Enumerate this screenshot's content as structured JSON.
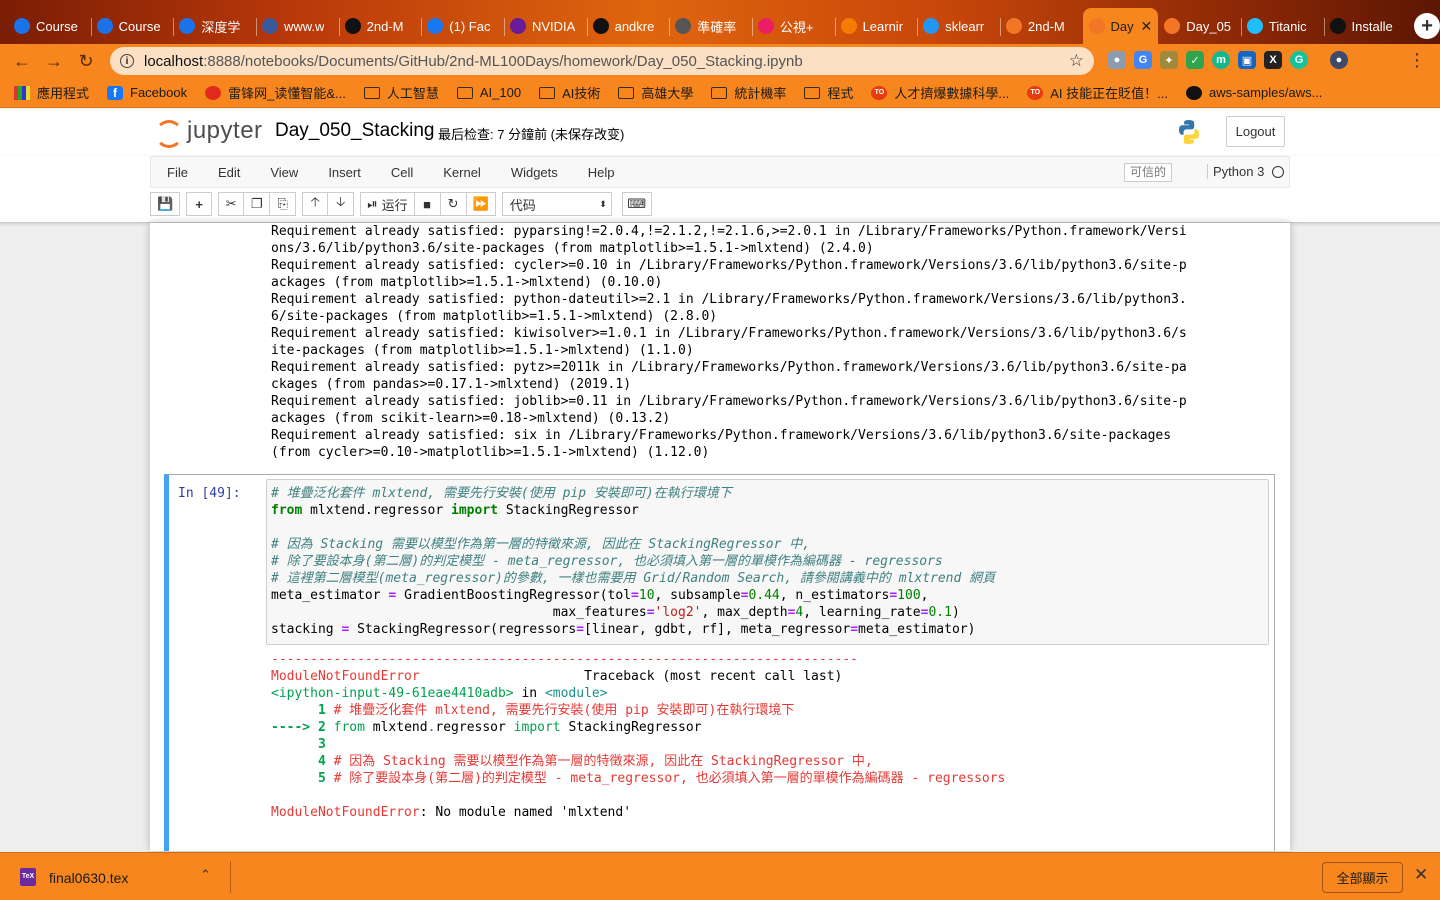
{
  "browser": {
    "tabs": [
      {
        "title": "Course",
        "icon": "infinity-icon",
        "color": "#1a73e8"
      },
      {
        "title": "Course",
        "icon": "infinity-icon",
        "color": "#1a73e8"
      },
      {
        "title": "深度学",
        "icon": "infinity-icon",
        "color": "#1a73e8"
      },
      {
        "title": "www.w",
        "icon": "bookmark-icon",
        "color": "#3b5998"
      },
      {
        "title": "2nd-M",
        "icon": "github-icon",
        "color": "#111111"
      },
      {
        "title": "(1) Fac",
        "icon": "facebook-icon",
        "color": "#1877f2"
      },
      {
        "title": "NVIDIA",
        "icon": "nvidia-icon",
        "color": "#6a1b9a"
      },
      {
        "title": "andkre",
        "icon": "github-icon",
        "color": "#111111"
      },
      {
        "title": "準確率",
        "icon": "globe-icon",
        "color": "#555555"
      },
      {
        "title": "公視+",
        "icon": "heart-icon",
        "color": "#e91e63"
      },
      {
        "title": "Learnir",
        "icon": "hexagon-icon",
        "color": "#f57c00"
      },
      {
        "title": "sklearr",
        "icon": "sklearn-icon",
        "color": "#2196f3"
      },
      {
        "title": "2nd-M",
        "icon": "jupyter-icon",
        "color": "#f37626"
      },
      {
        "title": "Day",
        "icon": "jupyter-book-icon",
        "color": "#f37626",
        "active": true
      },
      {
        "title": "Day_05",
        "icon": "jupyter-book-icon",
        "color": "#f37626"
      },
      {
        "title": "Titanic",
        "icon": "kaggle-icon",
        "color": "#20beff"
      },
      {
        "title": "Installe",
        "icon": "github-icon",
        "color": "#111111"
      }
    ],
    "url_host": "localhost",
    "url_path": ":8888/notebooks/Documents/GitHub/2nd-ML100Days/homework/Day_050_Stacking.ipynb",
    "bookmarks": [
      {
        "label": "應用程式",
        "icon": "apps-grid-icon"
      },
      {
        "label": "Facebook",
        "icon": "facebook-icon"
      },
      {
        "label": "雷锋网_读懂智能&...",
        "icon": "leifeng-icon"
      },
      {
        "label": "人工智慧",
        "icon": "folder-icon"
      },
      {
        "label": "AI_100",
        "icon": "folder-icon"
      },
      {
        "label": "AI技術",
        "icon": "folder-icon"
      },
      {
        "label": "高雄大學",
        "icon": "folder-icon"
      },
      {
        "label": "統計機率",
        "icon": "folder-icon"
      },
      {
        "label": "程式",
        "icon": "folder-icon"
      },
      {
        "label": "人才擠爆數據科學...",
        "icon": "to-icon"
      },
      {
        "label": "AI 技能正在貶值！...",
        "icon": "to-icon"
      },
      {
        "label": "aws-samples/aws...",
        "icon": "github-icon"
      }
    ]
  },
  "jupyter": {
    "logo_text": "jupyter",
    "notebook_name": "Day_050_Stacking",
    "checkpoint": "最后检查: 7 分鐘前  (未保存改变)",
    "logout": "Logout",
    "menu": [
      "File",
      "Edit",
      "View",
      "Insert",
      "Cell",
      "Kernel",
      "Widgets",
      "Help"
    ],
    "trusted": "可信的",
    "kernel": "Python 3",
    "run_label": "运行",
    "cell_type": "代码"
  },
  "output_lines": [
    "Requirement already satisfied: pyparsing!=2.0.4,!=2.1.2,!=2.1.6,>=2.0.1 in /Library/Frameworks/Python.framework/Versi",
    "ons/3.6/lib/python3.6/site-packages (from matplotlib>=1.5.1->mlxtend) (2.4.0)",
    "Requirement already satisfied: cycler>=0.10 in /Library/Frameworks/Python.framework/Versions/3.6/lib/python3.6/site-p",
    "ackages (from matplotlib>=1.5.1->mlxtend) (0.10.0)",
    "Requirement already satisfied: python-dateutil>=2.1 in /Library/Frameworks/Python.framework/Versions/3.6/lib/python3.",
    "6/site-packages (from matplotlib>=1.5.1->mlxtend) (2.8.0)",
    "Requirement already satisfied: kiwisolver>=1.0.1 in /Library/Frameworks/Python.framework/Versions/3.6/lib/python3.6/s",
    "ite-packages (from matplotlib>=1.5.1->mlxtend) (1.1.0)",
    "Requirement already satisfied: pytz>=2011k in /Library/Frameworks/Python.framework/Versions/3.6/lib/python3.6/site-pa",
    "ckages (from pandas>=0.17.1->mlxtend) (2019.1)",
    "Requirement already satisfied: joblib>=0.11 in /Library/Frameworks/Python.framework/Versions/3.6/lib/python3.6/site-p",
    "ackages (from scikit-learn>=0.18->mlxtend) (0.13.2)",
    "Requirement already satisfied: six in /Library/Frameworks/Python.framework/Versions/3.6/lib/python3.6/site-packages",
    "(from cycler>=0.10->matplotlib>=1.5.1->mlxtend) (1.12.0)"
  ],
  "cell": {
    "prompt": "In [49]:",
    "comment1": "# 堆疊泛化套件 mlxtend, 需要先行安裝(使用 pip 安裝即可)在執行環境下",
    "kw_from": "from",
    "module": "mlxtend.regressor",
    "kw_import": "import",
    "class_name": "StackingRegressor",
    "comment2": "# 因為 Stacking 需要以模型作為第一層的特徵來源, 因此在 StackingRegressor 中,",
    "comment3": "# 除了要設本身(第二層)的判定模型 - meta_regressor, 也必須填入第一層的單模作為編碼器 - regressors",
    "comment4": "# 這裡第二層模型(meta_regressor)的參數, 一樣也需要用 Grid/Random Search, 請參閱講義中的 mlxtrend 網頁",
    "meta_var": "meta_estimator",
    "gbr_call": "GradientBoostingRegressor(tol",
    "tol": "10",
    "subsample_key": ", subsample",
    "subsample": "0.44",
    "n_est_key": ", n_estimators",
    "n_est": "100",
    "indent": "                                    ",
    "max_feat_key": "max_features",
    "max_feat": "'log2'",
    "depth_key": ", max_depth",
    "depth": "4",
    "lr_key": ", learning_rate",
    "lr": "0.1",
    "stack_var": "stacking",
    "stack_call": "StackingRegressor(regressors",
    "stack_list": "[linear, gdbt, rf], meta_regressor",
    "stack_end": "meta_estimator)"
  },
  "traceback": {
    "dashes": "---------------------------------------------------------------------------",
    "err_name": "ModuleNotFoundError",
    "tb_label": "                     Traceback (most recent call last)",
    "input_ref": "<ipython-input-49-61eae4410adb>",
    "in_word": " in ",
    "module_ref": "<module>",
    "l1_num": "      1",
    "l1_text": " # 堆疊泛化套件 mlxtend, 需要先行安裝(使用 pip 安裝即可)在執行環境下",
    "arrow": "----> 2",
    "l2_kw": " from",
    "l2_mod": " mlxtend",
    "l2_dot": ".",
    "l2_sub": "regressor",
    "l2_import": " import",
    "l2_cls": " StackingRegressor",
    "l3_num": "      3",
    "l4_num": "      4",
    "l4_text": " # 因為 Stacking 需要以模型作為第一層的特徵來源, 因此在 StackingRegressor 中,",
    "l5_num": "      5",
    "l5_text": " # 除了要設本身(第二層)的判定模型 - meta_regressor, 也必須填入第一層的單模作為編碼器 - regressors",
    "final_msg": ": No module named 'mlxtend'"
  },
  "downloads": {
    "file": "final0630.tex",
    "show_all": "全部顯示"
  }
}
